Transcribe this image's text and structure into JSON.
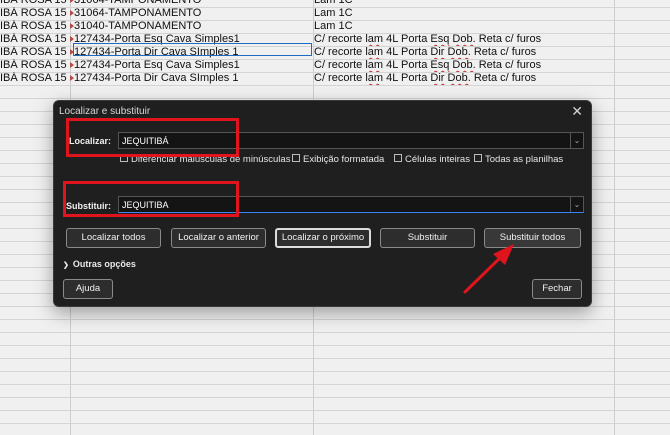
{
  "spreadsheet": {
    "rows": [
      {
        "a": "IBÁ ROSA 15",
        "b": "31064-TAMPONAMENTO",
        "c": [
          "Lam 1C"
        ]
      },
      {
        "a": "IBÁ ROSA 15",
        "b": "31064-TAMPONAMENTO",
        "c": [
          "Lam 1C"
        ]
      },
      {
        "a": "IBÁ ROSA 15",
        "b": "31040-TAMPONAMENTO",
        "c": [
          "Lam 1C"
        ]
      },
      {
        "a": "IBÁ ROSA 15",
        "b": "127434-Porta Esq Cava Simples1",
        "c": [
          "C/ recorte ",
          "lam",
          " 4L Porta ",
          "Esq",
          " ",
          "Dob.",
          " Reta c/ furos"
        ]
      },
      {
        "a": "IBÁ ROSA 15",
        "b": "127434-Porta Dir Cava SImples 1",
        "c": [
          "C/ recorte ",
          "lam",
          " 4L Porta ",
          "Dir",
          " ",
          "Dob.",
          " Reta c/ furos"
        ]
      },
      {
        "a": "IBÁ ROSA 15",
        "b": "127434-Porta Esq Cava Simples1",
        "c": [
          "C/ recorte ",
          "lam",
          " 4L Porta ",
          "Esq",
          " ",
          "Dob.",
          " Reta c/ furos"
        ]
      },
      {
        "a": "IBÁ ROSA 15",
        "b": "127434-Porta Dir Cava SImples 1",
        "c": [
          "C/ recorte ",
          "lam",
          " 4L Porta ",
          "Dir",
          " ",
          "Dob.",
          " Reta c/ furos"
        ]
      }
    ]
  },
  "dialog": {
    "title": "Localizar e substituir",
    "find_label": "Localizar:",
    "find_value": "JEQUITIBÁ",
    "options": [
      "Diferenciar maiúsculas de minúsculas",
      "Exibição formatada",
      "Células inteiras",
      "Todas as planilhas"
    ],
    "replace_label": "Substituir:",
    "replace_value": "JEQUITIBA",
    "buttons": {
      "find_all": "Localizar todos",
      "find_previous": "Localizar o anterior",
      "find_next": "Localizar o próximo",
      "replace": "Substituir",
      "replace_all": "Substituir todos"
    },
    "more_options": "Outras opções",
    "help": "Ajuda",
    "close": "Fechar"
  },
  "colors": {
    "highlight": "#e0141c",
    "dialog_bg": "#1f1f1f"
  }
}
